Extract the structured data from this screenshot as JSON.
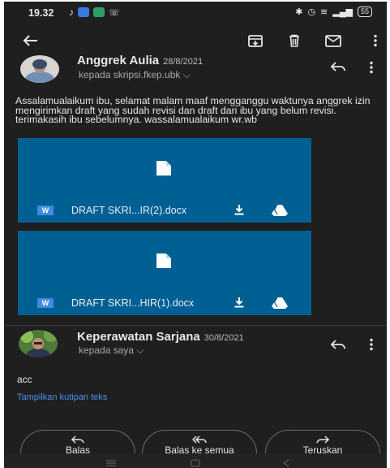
{
  "status_bar": {
    "time": "19.32",
    "battery": "55"
  },
  "message1": {
    "sender": "Anggrek Aulia",
    "date": "28/8/2021",
    "recipient": "kepada skripsi.fkep.ubk",
    "body": "Assalamualaikum ibu, selamat malam maaf mengganggu waktunya anggrek izin mengirimkan draft yang sudah revisi dan draft dari ibu yang belum revisi. terimakasih ibu sebelumnya. wassalamualaikum wr.wb"
  },
  "attachments": [
    {
      "badge": "W",
      "name": "DRAFT SKRI...IR(2).docx"
    },
    {
      "badge": "W",
      "name": "DRAFT SKRI...HIR(1).docx"
    }
  ],
  "message2": {
    "sender": "Keperawatan Sarjana",
    "date": "30/8/2021",
    "recipient": "kepada saya",
    "body": "acc",
    "show_quote": "Tampilkan kutipan teks"
  },
  "actions": {
    "reply": "Balas",
    "reply_all": "Balas ke semua",
    "forward": "Teruskan"
  },
  "icons": {
    "back": "back-arrow-icon",
    "archive": "archive-icon",
    "delete": "trash-icon",
    "mail": "mail-icon",
    "more": "more-vert-icon"
  },
  "colors": {
    "background": "#1f1f1f",
    "attachment": "#005f93",
    "link": "#4a8df0",
    "text": "#e6e6e6"
  }
}
